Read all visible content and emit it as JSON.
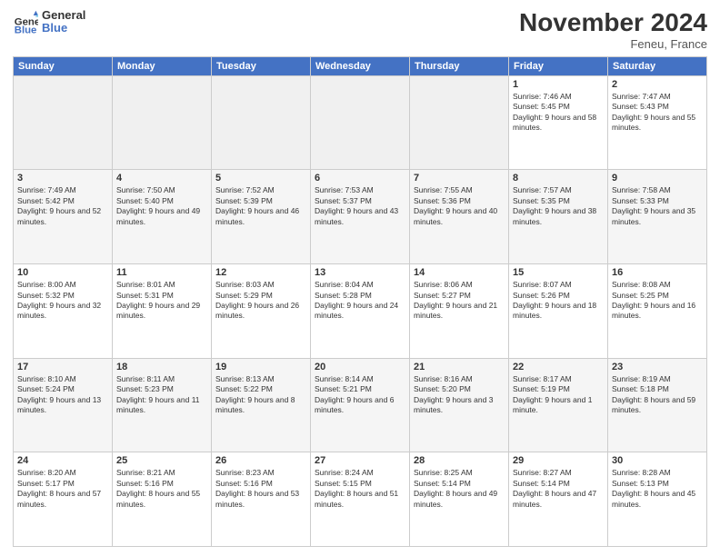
{
  "logo": {
    "general": "General",
    "blue": "Blue"
  },
  "header": {
    "month_title": "November 2024",
    "location": "Feneu, France"
  },
  "days_of_week": [
    "Sunday",
    "Monday",
    "Tuesday",
    "Wednesday",
    "Thursday",
    "Friday",
    "Saturday"
  ],
  "weeks": [
    [
      {
        "day": "",
        "info": ""
      },
      {
        "day": "",
        "info": ""
      },
      {
        "day": "",
        "info": ""
      },
      {
        "day": "",
        "info": ""
      },
      {
        "day": "",
        "info": ""
      },
      {
        "day": "1",
        "info": "Sunrise: 7:46 AM\nSunset: 5:45 PM\nDaylight: 9 hours and 58 minutes."
      },
      {
        "day": "2",
        "info": "Sunrise: 7:47 AM\nSunset: 5:43 PM\nDaylight: 9 hours and 55 minutes."
      }
    ],
    [
      {
        "day": "3",
        "info": "Sunrise: 7:49 AM\nSunset: 5:42 PM\nDaylight: 9 hours and 52 minutes."
      },
      {
        "day": "4",
        "info": "Sunrise: 7:50 AM\nSunset: 5:40 PM\nDaylight: 9 hours and 49 minutes."
      },
      {
        "day": "5",
        "info": "Sunrise: 7:52 AM\nSunset: 5:39 PM\nDaylight: 9 hours and 46 minutes."
      },
      {
        "day": "6",
        "info": "Sunrise: 7:53 AM\nSunset: 5:37 PM\nDaylight: 9 hours and 43 minutes."
      },
      {
        "day": "7",
        "info": "Sunrise: 7:55 AM\nSunset: 5:36 PM\nDaylight: 9 hours and 40 minutes."
      },
      {
        "day": "8",
        "info": "Sunrise: 7:57 AM\nSunset: 5:35 PM\nDaylight: 9 hours and 38 minutes."
      },
      {
        "day": "9",
        "info": "Sunrise: 7:58 AM\nSunset: 5:33 PM\nDaylight: 9 hours and 35 minutes."
      }
    ],
    [
      {
        "day": "10",
        "info": "Sunrise: 8:00 AM\nSunset: 5:32 PM\nDaylight: 9 hours and 32 minutes."
      },
      {
        "day": "11",
        "info": "Sunrise: 8:01 AM\nSunset: 5:31 PM\nDaylight: 9 hours and 29 minutes."
      },
      {
        "day": "12",
        "info": "Sunrise: 8:03 AM\nSunset: 5:29 PM\nDaylight: 9 hours and 26 minutes."
      },
      {
        "day": "13",
        "info": "Sunrise: 8:04 AM\nSunset: 5:28 PM\nDaylight: 9 hours and 24 minutes."
      },
      {
        "day": "14",
        "info": "Sunrise: 8:06 AM\nSunset: 5:27 PM\nDaylight: 9 hours and 21 minutes."
      },
      {
        "day": "15",
        "info": "Sunrise: 8:07 AM\nSunset: 5:26 PM\nDaylight: 9 hours and 18 minutes."
      },
      {
        "day": "16",
        "info": "Sunrise: 8:08 AM\nSunset: 5:25 PM\nDaylight: 9 hours and 16 minutes."
      }
    ],
    [
      {
        "day": "17",
        "info": "Sunrise: 8:10 AM\nSunset: 5:24 PM\nDaylight: 9 hours and 13 minutes."
      },
      {
        "day": "18",
        "info": "Sunrise: 8:11 AM\nSunset: 5:23 PM\nDaylight: 9 hours and 11 minutes."
      },
      {
        "day": "19",
        "info": "Sunrise: 8:13 AM\nSunset: 5:22 PM\nDaylight: 9 hours and 8 minutes."
      },
      {
        "day": "20",
        "info": "Sunrise: 8:14 AM\nSunset: 5:21 PM\nDaylight: 9 hours and 6 minutes."
      },
      {
        "day": "21",
        "info": "Sunrise: 8:16 AM\nSunset: 5:20 PM\nDaylight: 9 hours and 3 minutes."
      },
      {
        "day": "22",
        "info": "Sunrise: 8:17 AM\nSunset: 5:19 PM\nDaylight: 9 hours and 1 minute."
      },
      {
        "day": "23",
        "info": "Sunrise: 8:19 AM\nSunset: 5:18 PM\nDaylight: 8 hours and 59 minutes."
      }
    ],
    [
      {
        "day": "24",
        "info": "Sunrise: 8:20 AM\nSunset: 5:17 PM\nDaylight: 8 hours and 57 minutes."
      },
      {
        "day": "25",
        "info": "Sunrise: 8:21 AM\nSunset: 5:16 PM\nDaylight: 8 hours and 55 minutes."
      },
      {
        "day": "26",
        "info": "Sunrise: 8:23 AM\nSunset: 5:16 PM\nDaylight: 8 hours and 53 minutes."
      },
      {
        "day": "27",
        "info": "Sunrise: 8:24 AM\nSunset: 5:15 PM\nDaylight: 8 hours and 51 minutes."
      },
      {
        "day": "28",
        "info": "Sunrise: 8:25 AM\nSunset: 5:14 PM\nDaylight: 8 hours and 49 minutes."
      },
      {
        "day": "29",
        "info": "Sunrise: 8:27 AM\nSunset: 5:14 PM\nDaylight: 8 hours and 47 minutes."
      },
      {
        "day": "30",
        "info": "Sunrise: 8:28 AM\nSunset: 5:13 PM\nDaylight: 8 hours and 45 minutes."
      }
    ]
  ]
}
